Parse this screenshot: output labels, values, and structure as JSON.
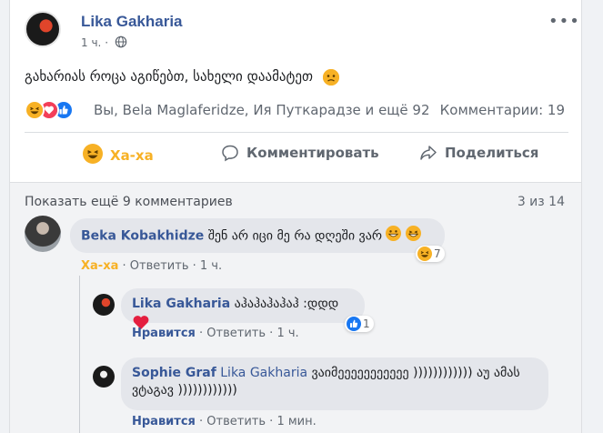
{
  "post": {
    "author": "Lika Gakharia",
    "time": "1 ч.",
    "separator": "·",
    "more": "•••",
    "text": "გახარიას როცა აგიწებთ, სახელი დაამატეთ",
    "reactions_text": "Вы, Bela Maglaferidze, Ия Путкарадзе и ещё 92",
    "comments_count": "Комментарии: 19"
  },
  "actions": {
    "haha": "Ха-ха",
    "comment": "Комментировать",
    "share": "Поделиться"
  },
  "comments_header": {
    "show_more": "Показать ещё 9 комментариев",
    "pager": "3 из 14"
  },
  "comments": [
    {
      "author": "Beka Kobakhidze",
      "text": "შენ არ იცი მე რა დღეში ვარ",
      "reaction_link": "Ха-ха",
      "reply": "Ответить",
      "time": "1 ч.",
      "badge_count": "7"
    },
    {
      "author": "Lika Gakharia",
      "text": "აჰაჰაჰაჰაჰ :დდდ",
      "reaction_link": "Нравится",
      "reply": "Ответить",
      "time": "1 ч.",
      "badge_count": "1"
    },
    {
      "author": "Sophie Graf",
      "mention": "Lika Gakharia",
      "text_line1": "ვაიმეეეეეეეეეეე )))))))))))) აუ ამას",
      "text_line2": "ვტაგავ ))))))))))))",
      "reaction_link": "Нравится",
      "reply": "Ответить",
      "time": "1 мин."
    }
  ],
  "colors": {
    "link_blue": "#385898",
    "haha_yellow": "#f7b125",
    "like_blue": "#1877f2",
    "love_red": "#f33e58",
    "muted": "#606770"
  },
  "icons": [
    "globe-icon",
    "haha-icon",
    "love-icon",
    "like-icon",
    "sad-icon",
    "comment-icon",
    "share-icon",
    "grin-icon",
    "heart-icon"
  ]
}
